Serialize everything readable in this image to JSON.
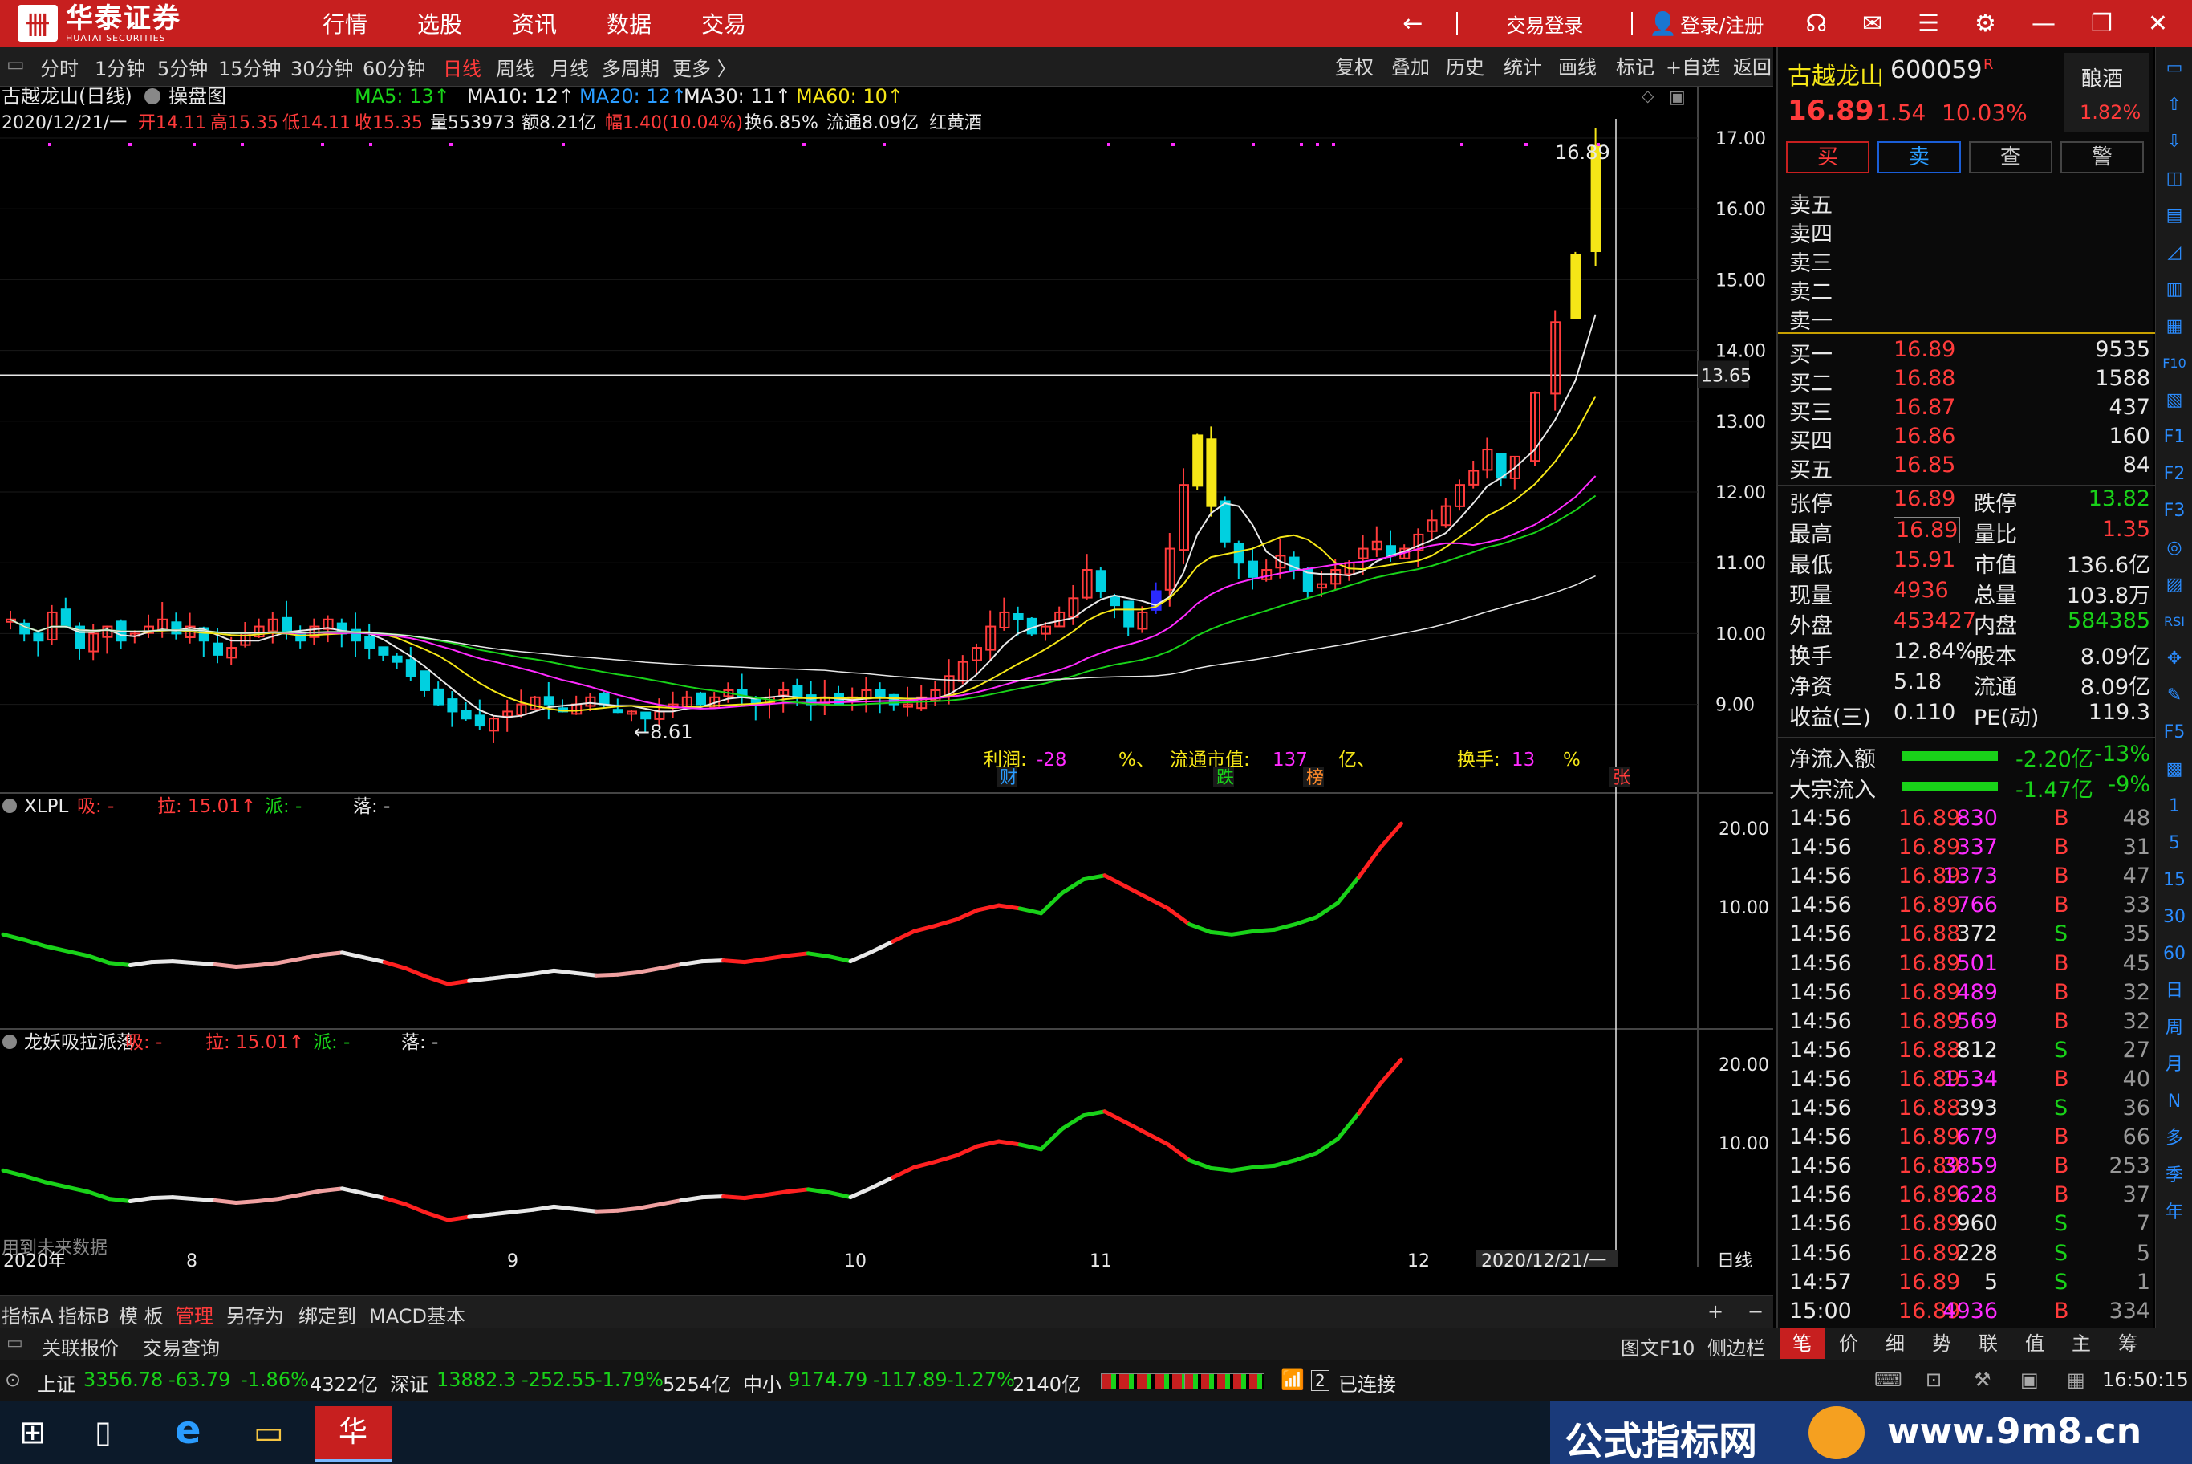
{
  "app": {
    "logo_cn": "华泰证券",
    "logo_en": "HUATAI SECURITIES",
    "nav": [
      "行情",
      "选股",
      "资讯",
      "数据",
      "交易"
    ],
    "back": "←",
    "login_trade": "交易登录",
    "login_reg": "登录/注册",
    "win_min": "—",
    "win_max": "❐",
    "win_close": "✕"
  },
  "toolbar": {
    "periods": [
      "分时",
      "1分钟",
      "5分钟",
      "15分钟",
      "30分钟",
      "60分钟",
      "日线",
      "周线",
      "月线",
      "多周期",
      "更多 〉"
    ],
    "active": "日线",
    "right": [
      "复权",
      "叠加",
      "历史",
      "统计",
      "画线",
      "标记",
      "+自选",
      "返回"
    ]
  },
  "chart": {
    "stock_title": "古越龙山(日线)",
    "mode": "操盘图",
    "ma_labels": [
      {
        "t": "MA5: 13↑",
        "c": "#19d219"
      },
      {
        "t": "MA10: 12↑",
        "c": "#e8e8e8"
      },
      {
        "t": "MA20: 12↑",
        "c": "#2a9cff"
      },
      {
        "t": "MA30: 11↑",
        "c": "#e8e8e8"
      },
      {
        "t": "MA60: 10↑",
        "c": "#f5e617"
      }
    ],
    "info_date": "2020/12/21/一",
    "info_open": "开14.11",
    "info_high": "高15.35",
    "info_low": "低14.11",
    "info_close": "收15.35",
    "info_vol": "量553973",
    "info_amt": "额8.21亿",
    "info_chg": "幅1.40(10.04%)",
    "info_turn": "换6.85%",
    "info_float": "流通8.09亿",
    "info_concept": "红黄酒",
    "price_axis": [
      "17.00",
      "16.00",
      "15.00",
      "14.00",
      "13.00",
      "12.00",
      "11.00",
      "10.00",
      "9.00"
    ],
    "hline_price": "13.65",
    "peak_label": "16.89",
    "low_label": "←8.61",
    "fund_profit_label": "利润:",
    "fund_profit_val": "-28",
    "fund_profit_unit": "%、",
    "fund_mv_label": "流通市值:",
    "fund_mv_val": "137",
    "fund_mv_unit": "亿、",
    "fund_turn_label": "换手:",
    "fund_turn_val": "13",
    "fund_turn_unit": "%",
    "markers": [
      {
        "t": "财",
        "c": "#2a9cff"
      },
      {
        "t": "跌",
        "c": "#19d219"
      },
      {
        "t": "榜",
        "c": "#ff8a2a"
      },
      {
        "t": "张",
        "c": "#ff3b3b"
      }
    ],
    "ind1_name": "XLPL",
    "ind2_name": "龙妖吸拉派落",
    "ind_xi": "吸: -",
    "ind_la": "拉: 15.01↑",
    "ind_pai": "派: -",
    "ind_luo": "落: -",
    "ind_axis": [
      "20.00",
      "10.00"
    ],
    "future_warning": "用到未来数据",
    "x_axis": [
      "2020年",
      "8",
      "9",
      "10",
      "11",
      "12"
    ],
    "x_cursor": "2020/12/21/一",
    "period_label": "日线"
  },
  "bottombar": {
    "items": [
      "指标A",
      "指标B",
      "模 板",
      "管理",
      "另存为",
      "绑定到",
      "MACD基本"
    ],
    "active": "管理",
    "plus": "+",
    "minus": "−"
  },
  "tabbar": {
    "left": [
      "关联报价",
      "交易查询"
    ],
    "right1": "图文F10",
    "right2": "侧边栏",
    "tabs": [
      "笔",
      "价",
      "细",
      "势",
      "联",
      "值",
      "主",
      "筹"
    ]
  },
  "status": {
    "sh_name": "上证",
    "sh_val": "3356.78",
    "sh_chg": "-63.79",
    "sh_pct": "-1.86%",
    "sh_amt": "4322亿",
    "sz_name": "深证",
    "sz_val": "13882.3",
    "sz_chg": "-252.55",
    "sz_pct": "-1.79%",
    "sz_amt": "5254亿",
    "zx_name": "中小",
    "zx_val": "9174.79",
    "zx_chg": "-117.89",
    "zx_pct": "-1.27%",
    "zx_amt": "2140亿",
    "conn": "已连接",
    "conn_num": "2",
    "time": "16:50:15"
  },
  "watermark": {
    "t1": "公式指标网",
    "t2": "www.9m8.cn"
  },
  "quote": {
    "name": "古越龙山",
    "code": "600059",
    "flag": "R",
    "sector": "酿酒",
    "sector_pct": "1.82%",
    "price": "16.89",
    "chg": "1.54",
    "pct": "10.03%",
    "buttons": [
      "买",
      "卖",
      "查",
      "警"
    ],
    "sells": [
      "卖五",
      "卖四",
      "卖三",
      "卖二",
      "卖一"
    ],
    "buys": [
      {
        "l": "买一",
        "p": "16.89",
        "v": "9535"
      },
      {
        "l": "买二",
        "p": "16.88",
        "v": "1588"
      },
      {
        "l": "买三",
        "p": "16.87",
        "v": "437"
      },
      {
        "l": "买四",
        "p": "16.86",
        "v": "160"
      },
      {
        "l": "买五",
        "p": "16.85",
        "v": "84"
      }
    ],
    "stats": [
      {
        "l1": "张停",
        "v1": "16.89",
        "c1": "red",
        "l2": "跌停",
        "v2": "13.82",
        "c2": "grn"
      },
      {
        "l1": "最高",
        "v1": "16.89",
        "c1": "red",
        "l2": "量比",
        "v2": "1.35",
        "c2": "red"
      },
      {
        "l1": "最低",
        "v1": "15.91",
        "c1": "red",
        "l2": "市值",
        "v2": "136.6亿",
        "c2": "wht"
      },
      {
        "l1": "现量",
        "v1": "4936",
        "c1": "red",
        "l2": "总量",
        "v2": "103.8万",
        "c2": "wht"
      },
      {
        "l1": "外盘",
        "v1": "453427",
        "c1": "red",
        "l2": "内盘",
        "v2": "584385",
        "c2": "grn"
      },
      {
        "l1": "换手",
        "v1": "12.84%",
        "c1": "wht",
        "l2": "股本",
        "v2": "8.09亿",
        "c2": "wht"
      },
      {
        "l1": "净资",
        "v1": "5.18",
        "c1": "wht",
        "l2": "流通",
        "v2": "8.09亿",
        "c2": "wht"
      },
      {
        "l1": "收益(三)",
        "v1": "0.110",
        "c1": "wht",
        "l2": "PE(动)",
        "v2": "119.3",
        "c2": "wht"
      }
    ],
    "flow": [
      {
        "l": "净流入额",
        "v": "-2.20亿",
        "p": "-13%"
      },
      {
        "l": "大宗流入",
        "v": "-1.47亿",
        "p": "-9%"
      }
    ],
    "ticks": [
      [
        "14:56",
        "16.89",
        "830",
        "B",
        "48"
      ],
      [
        "14:56",
        "16.89",
        "337",
        "B",
        "31"
      ],
      [
        "14:56",
        "16.89",
        "1373",
        "B",
        "47"
      ],
      [
        "14:56",
        "16.89",
        "766",
        "B",
        "33"
      ],
      [
        "14:56",
        "16.88",
        "372",
        "S",
        "35"
      ],
      [
        "14:56",
        "16.89",
        "501",
        "B",
        "45"
      ],
      [
        "14:56",
        "16.89",
        "489",
        "B",
        "32"
      ],
      [
        "14:56",
        "16.89",
        "569",
        "B",
        "32"
      ],
      [
        "14:56",
        "16.88",
        "812",
        "S",
        "27"
      ],
      [
        "14:56",
        "16.89",
        "1534",
        "B",
        "40"
      ],
      [
        "14:56",
        "16.88",
        "393",
        "S",
        "36"
      ],
      [
        "14:56",
        "16.89",
        "679",
        "B",
        "66"
      ],
      [
        "14:56",
        "16.89",
        "3859",
        "B",
        "253"
      ],
      [
        "14:56",
        "16.89",
        "628",
        "B",
        "37"
      ],
      [
        "14:56",
        "16.89",
        "960",
        "S",
        "7"
      ],
      [
        "14:56",
        "16.89",
        "228",
        "S",
        "5"
      ],
      [
        "14:57",
        "16.89",
        "5",
        "S",
        "1"
      ],
      [
        "15:00",
        "16.89",
        "4936",
        "B",
        "334"
      ]
    ]
  },
  "side_strip": [
    "▭",
    "⇧",
    "⇩",
    "◫",
    "▤",
    "◿",
    "▥",
    "▦",
    "F10",
    "▧",
    "F1",
    "F2",
    "F3",
    "◎",
    "▨",
    "RSI",
    "✥",
    "✎",
    "F5",
    "▩",
    "1",
    "5",
    "15",
    "30",
    "60",
    "日",
    "周",
    "月",
    "N",
    "多",
    "季",
    "年"
  ],
  "taskbar": {
    "icons": [
      "⊞",
      "▯",
      "e",
      "▭",
      "华"
    ]
  }
}
